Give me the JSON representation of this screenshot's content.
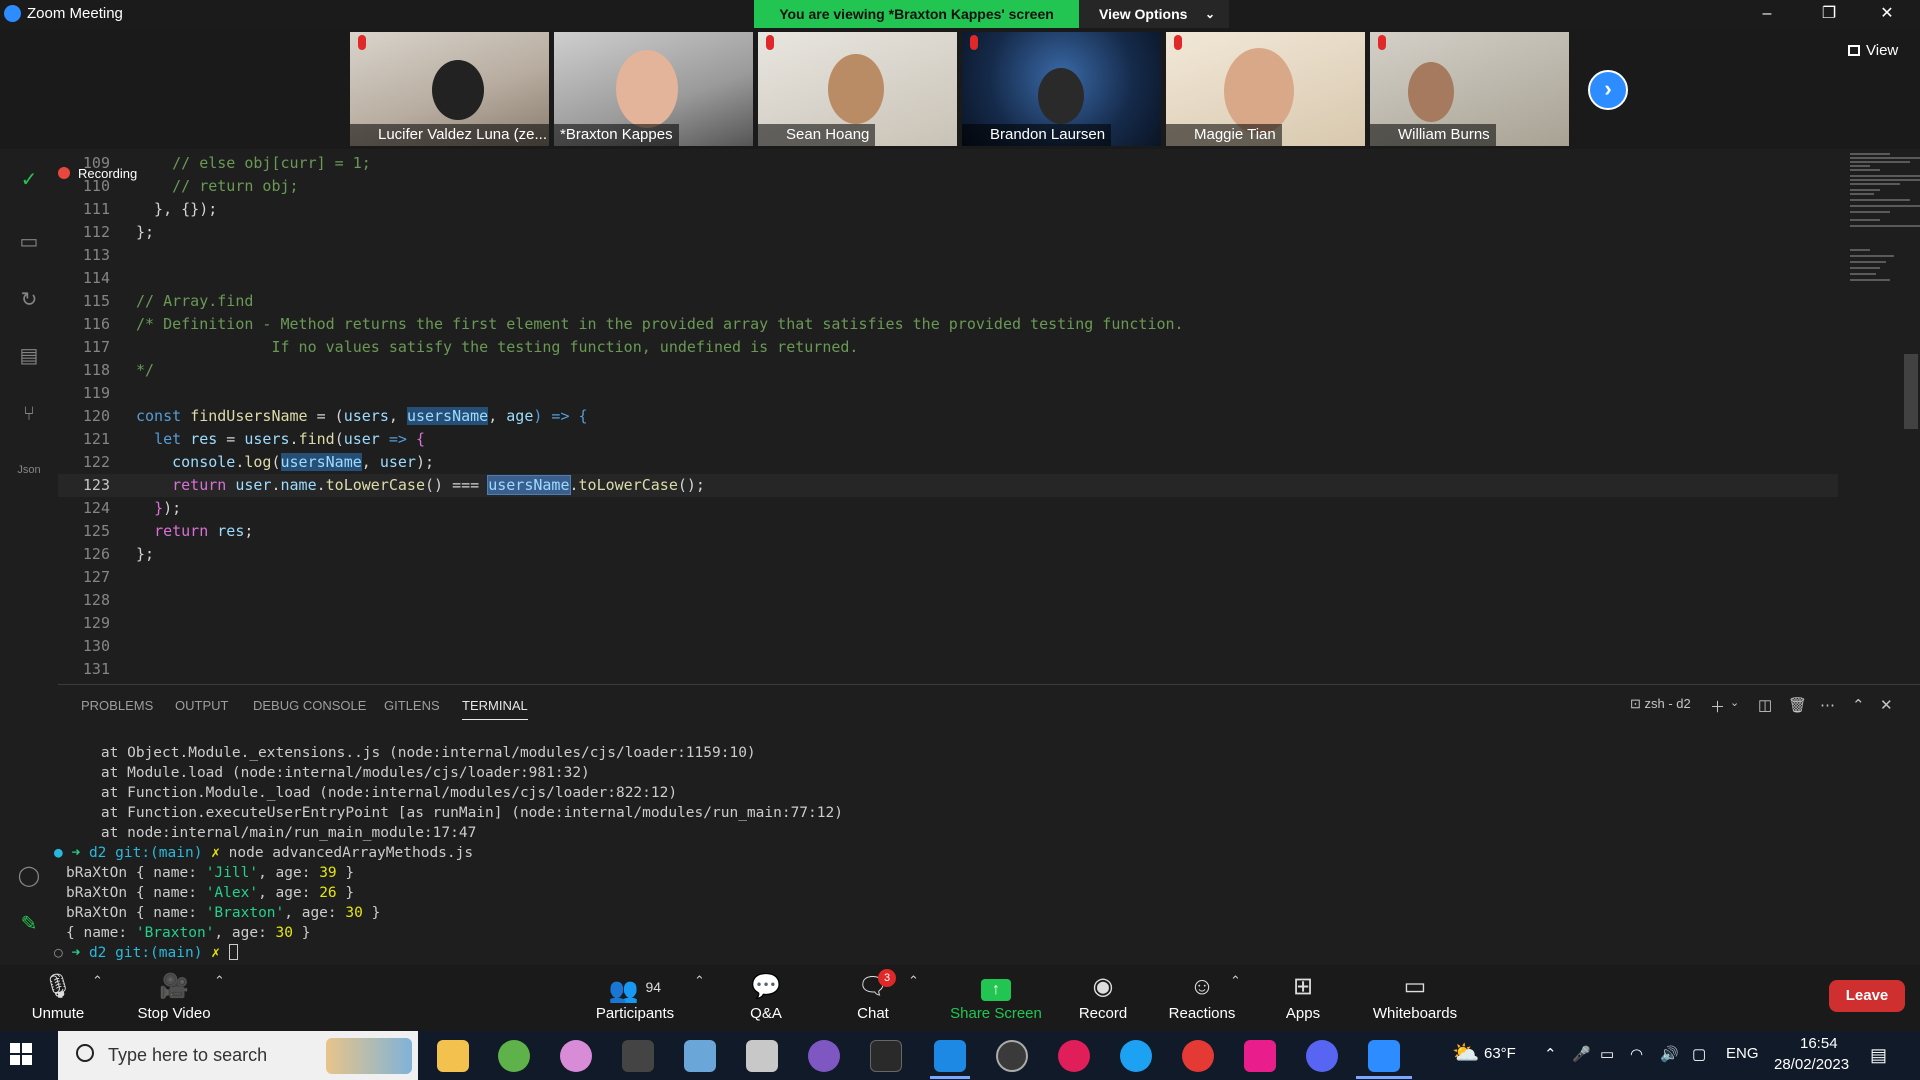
{
  "window": {
    "title": "Zoom Meeting",
    "viewing_banner": "You are viewing *Braxton Kappes' screen",
    "view_options": "View Options",
    "view_button": "View"
  },
  "participants": [
    {
      "name": "Lucifer Valdez Luna (ze...",
      "muted": true
    },
    {
      "name": "*Braxton Kappes",
      "muted": false,
      "active_speaker": true
    },
    {
      "name": "Sean Hoang",
      "muted": true
    },
    {
      "name": "Brandon Laursen",
      "muted": true
    },
    {
      "name": "Maggie Tian",
      "muted": true
    },
    {
      "name": "William Burns",
      "muted": true
    }
  ],
  "recording_label": "Recording",
  "editor": {
    "lines": [
      {
        "n": "109",
        "text": "    // else obj[curr] = 1;",
        "kind": "comment"
      },
      {
        "n": "110",
        "text": "    // return obj;",
        "kind": "comment"
      },
      {
        "n": "111",
        "text": "  }, {});",
        "kind": "code"
      },
      {
        "n": "112",
        "text": "};",
        "kind": "code"
      },
      {
        "n": "113",
        "text": "",
        "kind": "code"
      },
      {
        "n": "114",
        "text": "",
        "kind": "code"
      },
      {
        "n": "115",
        "text": "// Array.find",
        "kind": "comment"
      },
      {
        "n": "116",
        "text": "/* Definition - Method returns the first element in the provided array that satisfies the provided testing function.",
        "kind": "comment"
      },
      {
        "n": "117",
        "text": "               If no values satisfy the testing function, undefined is returned.",
        "kind": "comment"
      },
      {
        "n": "118",
        "text": "*/",
        "kind": "comment"
      },
      {
        "n": "119",
        "text": "",
        "kind": "code"
      },
      {
        "n": "120",
        "text": "",
        "kind": "code"
      },
      {
        "n": "121",
        "text": "",
        "kind": "code"
      },
      {
        "n": "122",
        "text": "",
        "kind": "code"
      },
      {
        "n": "123",
        "text": "",
        "kind": "code"
      },
      {
        "n": "124",
        "text": "",
        "kind": "code"
      },
      {
        "n": "125",
        "text": "",
        "kind": "code"
      },
      {
        "n": "126",
        "text": "};",
        "kind": "code"
      },
      {
        "n": "127",
        "text": "",
        "kind": "code"
      },
      {
        "n": "128",
        "text": "",
        "kind": "code"
      },
      {
        "n": "129",
        "text": "",
        "kind": "code"
      },
      {
        "n": "130",
        "text": "",
        "kind": "code"
      },
      {
        "n": "131",
        "text": "",
        "kind": "code"
      }
    ],
    "rich": {
      "l120": {
        "kw": "const",
        "fn": "findUsersName",
        "eq": " = (",
        "p1": "users",
        "c1": ", ",
        "p2": "usersName",
        "c2": ", ",
        "p3": "age",
        "arrow": ") => {"
      },
      "l121": {
        "kw": "let",
        "v1": "res",
        "eq": " = ",
        "v2": "users",
        "dot": ".",
        "fn": "find",
        "open": "(",
        "v3": "user",
        "arrow": " => ",
        "brace": "{"
      },
      "l122": {
        "v1": "console",
        "dot": ".",
        "fn": "log",
        "open": "(",
        "v2": "usersName",
        "comma": ", ",
        "v3": "user",
        "close": ");"
      },
      "l123": {
        "kw": "return",
        "v1": "user",
        "d1": ".",
        "v2": "name",
        "d2": ".",
        "fn1": "toLowerCase",
        "call1": "() === ",
        "sel": "usersName",
        "d3": ".",
        "fn2": "toLowerCase",
        "call2": "();"
      },
      "l124": {
        "brace": "}",
        "rest": ");"
      },
      "l125": {
        "kw": "return",
        "v1": "res",
        "end": ";"
      }
    }
  },
  "panel": {
    "tabs": [
      "PROBLEMS",
      "OUTPUT",
      "DEBUG CONSOLE",
      "GITLENS",
      "TERMINAL"
    ],
    "active_tab": "TERMINAL",
    "terminal_name": "zsh - d2"
  },
  "terminal": {
    "stack": [
      "    at Object.Module._extensions..js (node:internal/modules/cjs/loader:1159:10)",
      "    at Module.load (node:internal/modules/cjs/loader:981:32)",
      "    at Function.Module._load (node:internal/modules/cjs/loader:822:12)",
      "    at Function.executeUserEntryPoint [as runMain] (node:internal/modules/run_main:77:12)",
      "    at node:internal/main/run_main_module:17:47"
    ],
    "prompt_dir": "d2",
    "prompt_git": "git:(main)",
    "prompt_x": "✗",
    "command": "node advancedArrayMethods.js",
    "outputs": [
      {
        "prefix": "bRaXtOn { name: ",
        "name": "'Jill'",
        "mid": ", age: ",
        "age": "39",
        "end": " }"
      },
      {
        "prefix": "bRaXtOn { name: ",
        "name": "'Alex'",
        "mid": ", age: ",
        "age": "26",
        "end": " }"
      },
      {
        "prefix": "bRaXtOn { name: ",
        "name": "'Braxton'",
        "mid": ", age: ",
        "age": "30",
        "end": " }"
      },
      {
        "prefix": "{ name: ",
        "name": "'Braxton'",
        "mid": ", age: ",
        "age": "30",
        "end": " }"
      }
    ]
  },
  "toolbar": {
    "unmute": "Unmute",
    "stop_video": "Stop Video",
    "participants": "Participants",
    "participant_count": "94",
    "qa": "Q&A",
    "chat": "Chat",
    "chat_badge": "3",
    "share_screen": "Share Screen",
    "record": "Record",
    "reactions": "Reactions",
    "apps": "Apps",
    "whiteboards": "Whiteboards",
    "leave": "Leave"
  },
  "taskbar": {
    "search_placeholder": "Type here to search",
    "weather": "63°F",
    "lang": "ENG",
    "time": "16:54",
    "date": "28/02/2023"
  },
  "colors": {
    "banner": "#23c552",
    "zoom_blue": "#2d8cff",
    "leave_red": "#cf2f2f"
  }
}
